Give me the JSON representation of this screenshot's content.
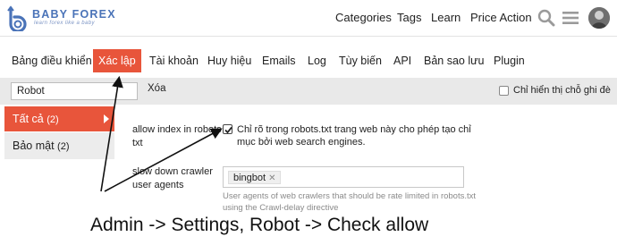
{
  "header": {
    "logo_text": "BABY FOREX",
    "logo_tagline": "learn forex like a baby",
    "nav": [
      "Categories",
      "Tags",
      "Learn",
      "Price Action"
    ]
  },
  "admin_tabs": [
    "Bảng điều khiển",
    "Xác lập",
    "Tài khoản",
    "Huy hiệu",
    "Emails",
    "Log",
    "Tùy biến",
    "API",
    "Bản sao lưu",
    "Plugin"
  ],
  "active_tab": "Xác lập",
  "filter": {
    "value": "Robot",
    "clear_label": "Xóa",
    "only_overridden_label": "Chỉ hiển thị chỗ ghi đè"
  },
  "sidebar": [
    {
      "label": "Tất cả",
      "count": "(2)",
      "active": true
    },
    {
      "label": "Bảo mật",
      "count": "(2)",
      "active": false
    }
  ],
  "settings": {
    "allow_index": {
      "label": "allow index in robots txt",
      "checked": true,
      "description": "Chỉ rõ trong robots.txt trang web này cho phép tạo chỉ mục bởi web search engines."
    },
    "slow_down": {
      "label": "slow down crawler user agents",
      "tags": [
        "bingbot"
      ],
      "hint": "User agents of web crawlers that should be rate limited in robots.txt using the Crawl-delay directive"
    }
  },
  "annotation": {
    "caption": "Admin -> Settings, Robot -> Check allow"
  },
  "colors": {
    "accent": "#e8553b",
    "logo_blue": "#4a73b8",
    "filter_bar": "#e9e9e9"
  }
}
